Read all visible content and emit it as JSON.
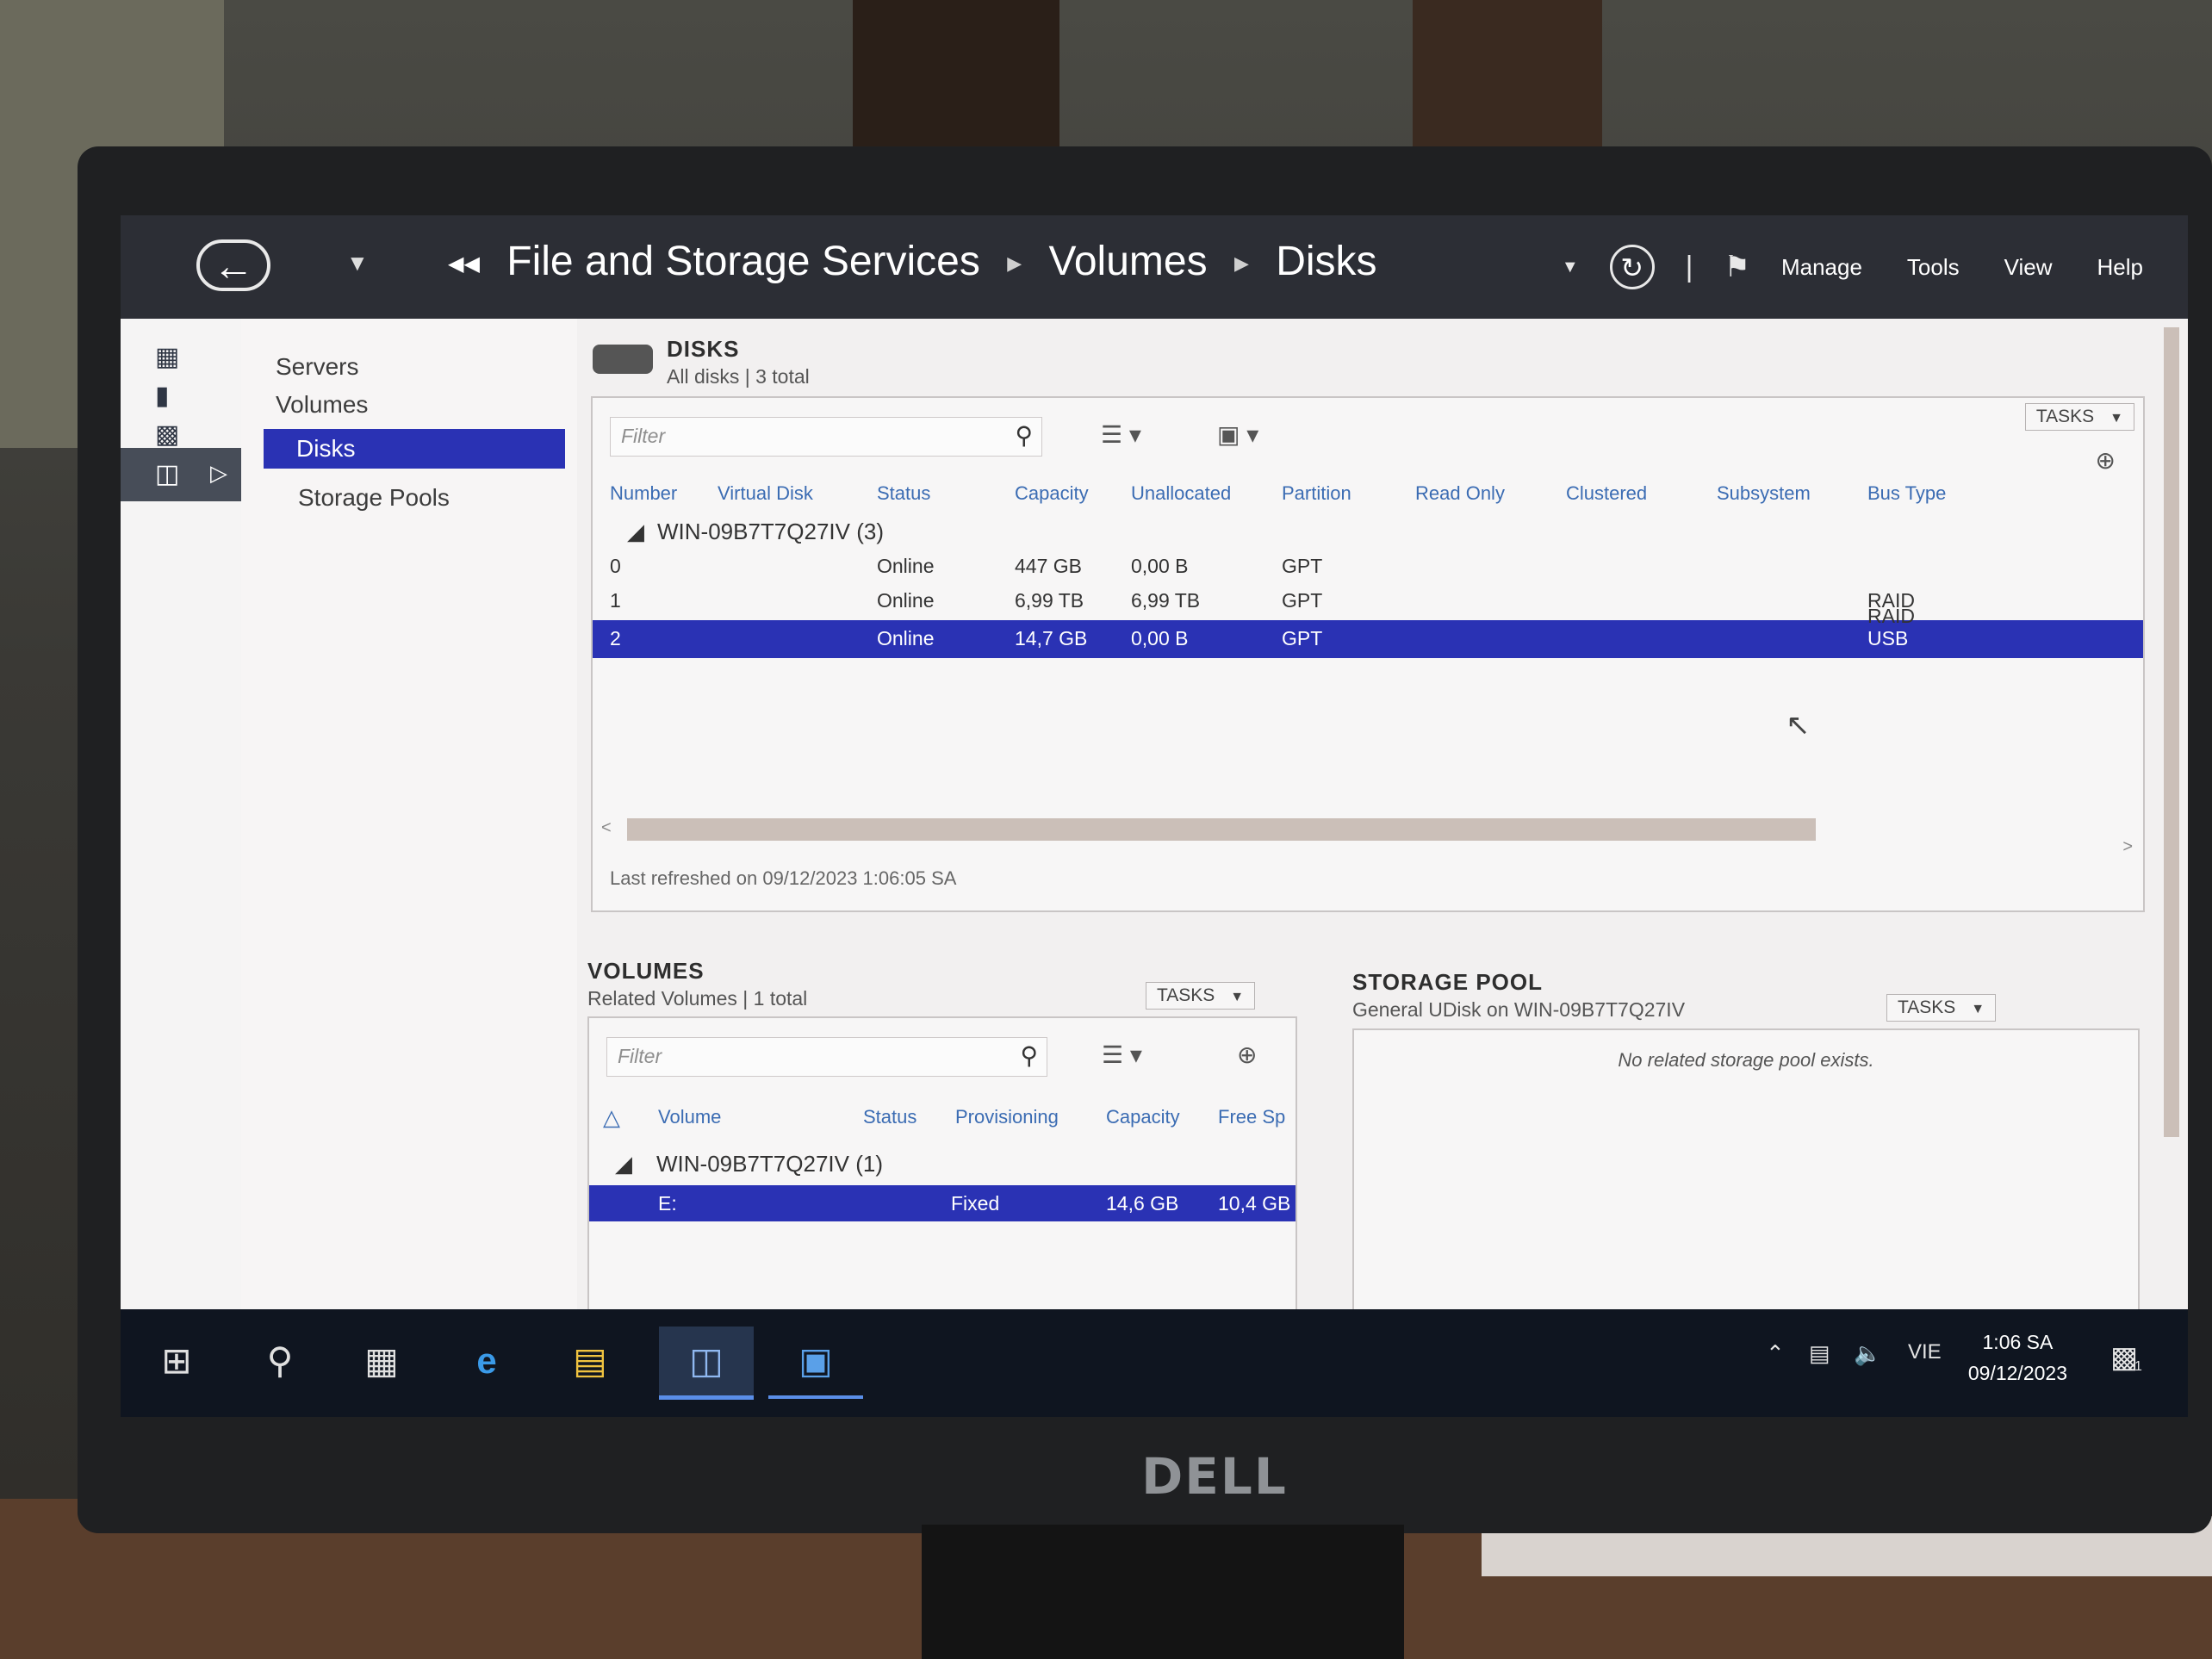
{
  "window": {
    "breadcrumb": [
      "File and Storage Services",
      "Volumes",
      "Disks"
    ],
    "menu": [
      "Manage",
      "Tools",
      "View",
      "Help"
    ]
  },
  "nav": {
    "items": [
      "Servers",
      "Volumes",
      "Disks",
      "Storage Pools"
    ],
    "selected": "Disks"
  },
  "disks": {
    "title": "DISKS",
    "subtitle": "All disks | 3 total",
    "tasks_label": "TASKS",
    "filter_placeholder": "Filter",
    "columns": [
      "Number",
      "Virtual Disk",
      "Status",
      "Capacity",
      "Unallocated",
      "Partition",
      "Read Only",
      "Clustered",
      "Subsystem",
      "Bus Type"
    ],
    "group": "WIN-09B7T7Q27IV (3)",
    "rows": [
      {
        "number": "0",
        "status": "Online",
        "capacity": "447 GB",
        "unallocated": "0,00 B",
        "partition": "GPT",
        "bus_type": ""
      },
      {
        "number": "1",
        "status": "Online",
        "capacity": "6,99 TB",
        "unallocated": "6,99 TB",
        "partition": "GPT",
        "bus_type": "RAID"
      },
      {
        "number": "2",
        "status": "Online",
        "capacity": "14,7 GB",
        "unallocated": "0,00 B",
        "partition": "GPT",
        "bus_type": "RAID"
      }
    ],
    "extra_bus_type": "USB",
    "last_refreshed": "Last refreshed on 09/12/2023 1:06:05 SA"
  },
  "volumes": {
    "title": "VOLUMES",
    "subtitle": "Related Volumes | 1 total",
    "tasks_label": "TASKS",
    "filter_placeholder": "Filter",
    "columns": [
      "Volume",
      "Status",
      "Provisioning",
      "Capacity",
      "Free Sp"
    ],
    "group": "WIN-09B7T7Q27IV (1)",
    "rows": [
      {
        "volume": "E:",
        "provisioning": "Fixed",
        "capacity": "14,6 GB",
        "free": "10,4 GB"
      }
    ]
  },
  "storage_pool": {
    "title": "STORAGE POOL",
    "subtitle": "General UDisk on WIN-09B7T7Q27IV",
    "tasks_label": "TASKS",
    "empty_message": "No related storage pool exists."
  },
  "taskbar": {
    "language": "VIE",
    "time": "1:06 SA",
    "date": "09/12/2023",
    "notification_count": "1"
  },
  "monitor_brand": "DELL"
}
